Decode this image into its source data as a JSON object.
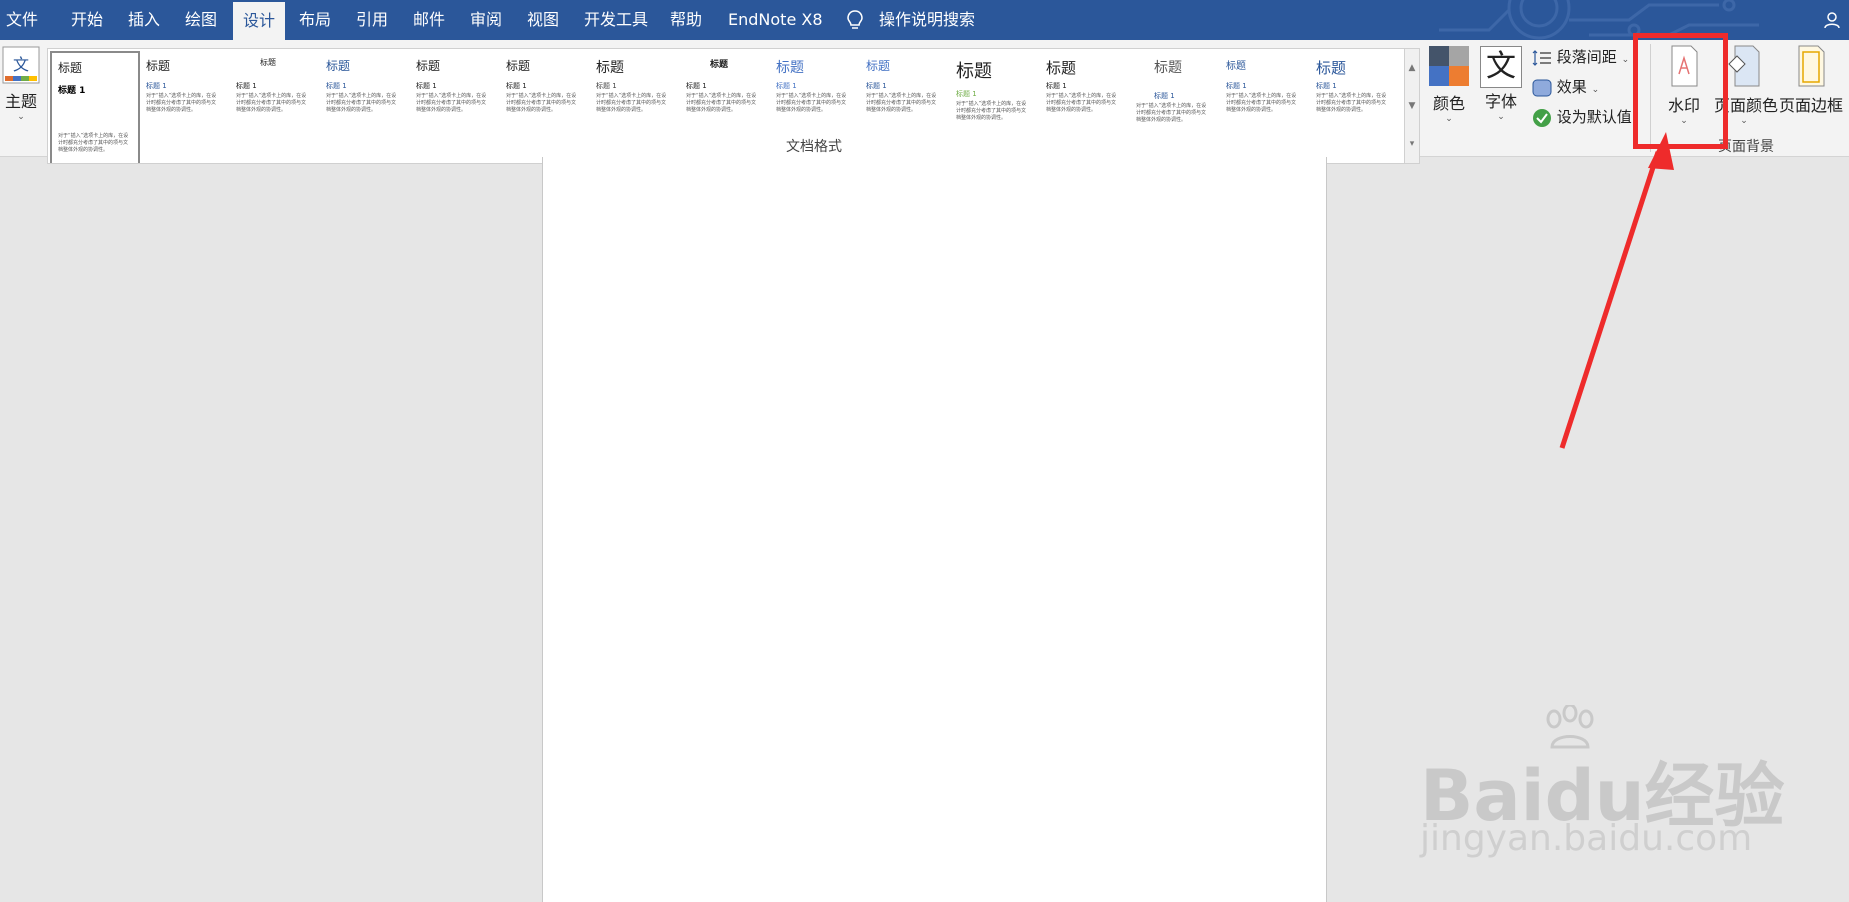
{
  "tabs": [
    "文件",
    "开始",
    "插入",
    "绘图",
    "设计",
    "布局",
    "引用",
    "邮件",
    "审阅",
    "视图",
    "开发工具",
    "帮助",
    "EndNote X8",
    "操作说明搜索"
  ],
  "active_tab": "设计",
  "ribbon": {
    "theme_label": "主题",
    "gallery": [
      {
        "title": "标题",
        "h1": "标题 1",
        "body": "对于“插入”选项卡上的库，在设计时都充分考虑了其中的项与文档整体外观的协调性。"
      },
      {
        "title": "标题",
        "h1": "标题 1",
        "body": "对于“插入”选项卡上的库，在设计时都充分考虑了其中的项与文档整体外观的协调性。"
      },
      {
        "title": "标题",
        "h1": "标题 1",
        "body": "对于“插入”选项卡上的库，在设计时都充分考虑了其中的项与文档整体外观的协调性。"
      },
      {
        "title": "标题",
        "h1": "标题 1",
        "body": "对于“插入”选项卡上的库，在设计时都充分考虑了其中的项与文档整体外观的协调性。"
      },
      {
        "title": "标题",
        "h1": "标题 1",
        "body": "对于“插入”选项卡上的库，在设计时都充分考虑了其中的项与文档整体外观的协调性。"
      },
      {
        "title": "标题",
        "h1": "标题 1",
        "body": "对于“插入”选项卡上的库，在设计时都充分考虑了其中的项与文档整体外观的协调性。"
      },
      {
        "title": "标题",
        "h1": "标题 1",
        "body": "对于“插入”选项卡上的库，在设计时都充分考虑了其中的项与文档整体外观的协调性。"
      },
      {
        "title": "标题",
        "h1": "标题 1",
        "body": "对于“插入”选项卡上的库，在设计时都充分考虑了其中的项与文档整体外观的协调性。"
      },
      {
        "title": "标题",
        "h1": "标题 1",
        "body": "对于“插入”选项卡上的库，在设计时都充分考虑了其中的项与文档整体外观的协调性。"
      },
      {
        "title": "标题",
        "h1": "标题 1",
        "body": "对于“插入”选项卡上的库，在设计时都充分考虑了其中的项与文档整体外观的协调性。"
      },
      {
        "title": "标题",
        "h1": "标题 1",
        "body": "对于“插入”选项卡上的库，在设计时都充分考虑了其中的项与文档整体外观的协调性。"
      },
      {
        "title": "标题",
        "h1": "标题 1",
        "body": "对于“插入”选项卡上的库，在设计时都充分考虑了其中的项与文档整体外观的协调性。"
      },
      {
        "title": "标题",
        "h1": "标题 1",
        "body": "对于“插入”选项卡上的库，在设计时都充分考虑了其中的项与文档整体外观的协调性。"
      },
      {
        "title": "标题",
        "h1": "标题 1",
        "body": "对于“插入”选项卡上的库，在设计时都充分考虑了其中的项与文档整体外观的协调性。"
      },
      {
        "title": "标题",
        "h1": "标题 1",
        "body": "对于“插入”选项卡上的库，在设计时都充分考虑了其中的项与文档整体外观的协调性。"
      },
      {
        "title": "标题",
        "h1": "标题 1",
        "body": "对于“插入”选项卡上的库，在设计时都充分考虑了其中的项与文档整体外观的协调性。"
      }
    ],
    "group_doc_format": "文档格式",
    "colors_label": "颜色",
    "fonts_label": "字体",
    "fonts_glyph": "文",
    "paragraph_spacing": "段落间距",
    "effects": "效果",
    "set_default": "设为默认值",
    "watermark": "水印",
    "page_color": "页面颜色",
    "page_borders": "页面边框",
    "group_page_bg": "页面背景"
  },
  "watermark_text": {
    "brand": "Baidu经验",
    "url": "jingyan.baidu.com"
  },
  "colors": {
    "accent": "#2b579a",
    "highlight": "#ee2b2b"
  }
}
